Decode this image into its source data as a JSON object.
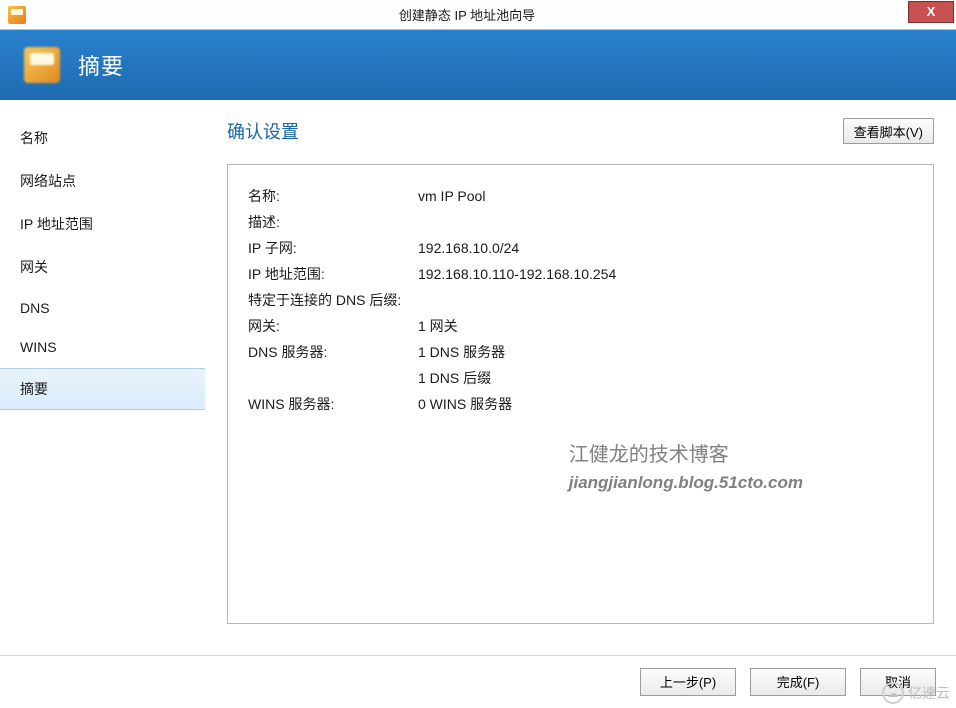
{
  "window": {
    "title": "创建静态 IP 地址池向导",
    "close_symbol": "X"
  },
  "banner": {
    "title": "摘要"
  },
  "sidebar": {
    "items": [
      {
        "label": "名称",
        "active": false
      },
      {
        "label": "网络站点",
        "active": false
      },
      {
        "label": "IP 地址范围",
        "active": false
      },
      {
        "label": "网关",
        "active": false
      },
      {
        "label": "DNS",
        "active": false
      },
      {
        "label": "WINS",
        "active": false
      },
      {
        "label": "摘要",
        "active": true
      }
    ]
  },
  "content": {
    "heading": "确认设置",
    "view_script_label": "查看脚本(V)",
    "rows": [
      {
        "label": "名称:",
        "value": "vm IP Pool"
      },
      {
        "label": "描述:",
        "value": ""
      },
      {
        "label": "IP 子网:",
        "value": "192.168.10.0/24"
      },
      {
        "label": "IP 地址范围:",
        "value": "192.168.10.110-192.168.10.254"
      },
      {
        "label": "特定于连接的 DNS 后缀:",
        "value": ""
      },
      {
        "label": "网关:",
        "value": "1 网关"
      },
      {
        "label": "DNS 服务器:",
        "value": "1 DNS 服务器"
      },
      {
        "label": "",
        "value": "1 DNS 后缀"
      },
      {
        "label": "WINS 服务器:",
        "value": "0 WINS 服务器"
      }
    ]
  },
  "watermark": {
    "line1": "江健龙的技术博客",
    "line2": "jiangjianlong.blog.51cto.com"
  },
  "corner_brand": "亿速云",
  "footer": {
    "previous": "上一步(P)",
    "finish": "完成(F)",
    "cancel": "取消"
  }
}
